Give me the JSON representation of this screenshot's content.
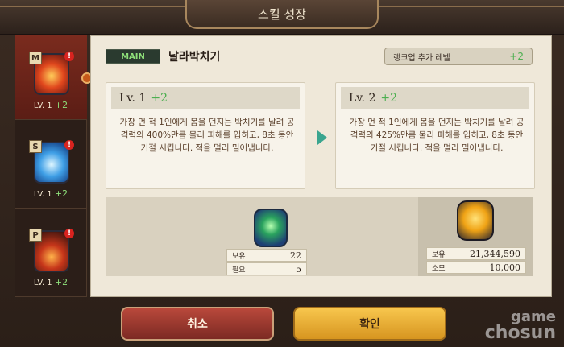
{
  "window": {
    "title": "스킬 성장"
  },
  "sidebar": {
    "items": [
      {
        "badge": "M",
        "alert": "!",
        "level_text": "LV. 1",
        "level_plus": "+2"
      },
      {
        "badge": "S",
        "alert": "!",
        "level_text": "LV. 1",
        "level_plus": "+2"
      },
      {
        "badge": "P",
        "alert": "!",
        "level_text": "LV. 1",
        "level_plus": "+2"
      }
    ]
  },
  "main": {
    "tag": "MAIN",
    "skill_name": "날라박치기",
    "rankup": {
      "label": "랭크업 추가 레벨",
      "value": "+2"
    },
    "current": {
      "level_label": "Lv. 1",
      "level_plus": "+2",
      "description": "가장 먼 적 1인에게 몸을 던지는 박치기를 날려 공격력의 400%만큼 물리 피해를 입히고, 8초 동안 기절 시킵니다. 적을 멀리 밀어냅니다."
    },
    "next": {
      "level_label": "Lv. 2",
      "level_plus": "+2",
      "description": "가장 먼 적 1인에게 몸을 던지는 박치기를 날려 공격력의 425%만큼 물리 피해를 입히고, 8초 동안 기절 시킵니다. 적을 멀리 밀어냅니다."
    },
    "resources": {
      "item": {
        "icon": "scroll-gem-icon",
        "have_label": "보유",
        "have_value": "22",
        "need_label": "필요",
        "need_value": "5"
      },
      "gold": {
        "icon": "gold-coin-icon",
        "have_label": "보유",
        "have_value": "21,344,590",
        "cost_label": "소모",
        "cost_value": "10,000"
      }
    }
  },
  "buttons": {
    "cancel": "취소",
    "confirm": "확인"
  },
  "watermark": {
    "line1": "game",
    "line2": "chosun"
  },
  "colors": {
    "accent_green": "#4caf50",
    "confirm_gold": "#f7c64d",
    "cancel_red": "#b9483b"
  }
}
